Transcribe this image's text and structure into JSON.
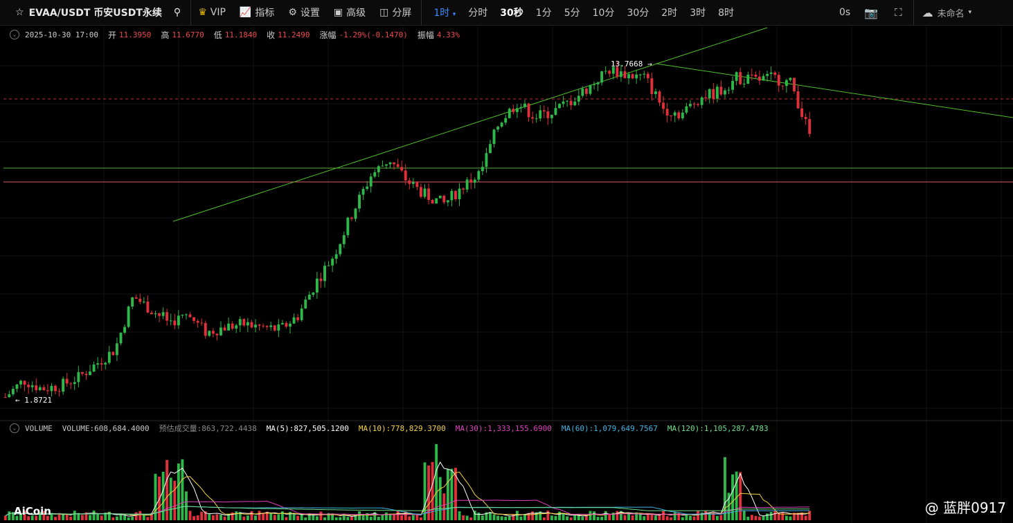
{
  "toolbar": {
    "symbol": "EVAA/USDT 币安USDT永续",
    "vip": "VIP",
    "indicators": "指标",
    "settings": "设置",
    "advanced": "高级",
    "split": "分屏",
    "current_interval": "1时",
    "intervals": [
      "分时",
      "30秒",
      "1分",
      "5分",
      "10分",
      "30分",
      "2时",
      "3时",
      "8时"
    ],
    "countdown": "0s",
    "layout_name": "未命名"
  },
  "ohlc": {
    "datetime": "2025-10-30 17:00",
    "open_label": "开",
    "open": "11.3950",
    "high_label": "高",
    "high": "11.6770",
    "low_label": "低",
    "low": "11.1840",
    "close_label": "收",
    "close": "11.2490",
    "change_label": "涨幅",
    "change": "-1.29%(-0.1470)",
    "amplitude_label": "振幅",
    "amplitude": "4.33%"
  },
  "annotations": {
    "high_marker": "13.7668 →",
    "low_marker": "← 1.8721"
  },
  "volume": {
    "title": "VOLUME",
    "value": "VOLUME:608,684.4000",
    "estimated": "预估成交量:863,722.4438",
    "ma5": "MA(5):827,505.1200",
    "ma10": "MA(10):778,829.3700",
    "ma30": "MA(30):1,333,155.6900",
    "ma60": "MA(60):1,079,649.7567",
    "ma120": "MA(120):1,105,287.4783"
  },
  "colors": {
    "up": "#2fb84a",
    "down": "#e0303a",
    "trend": "#4fbf2a",
    "ma5": "#ffffff",
    "ma10": "#f5d142",
    "ma30": "#e040c0",
    "ma60": "#3fb4e6",
    "ma120": "#6ee08a",
    "volume_label": "#c8c8c8",
    "estimated": "#8a8a8a"
  },
  "branding": {
    "logo": "AiCoin",
    "watermark": "@ 蓝胖0917"
  },
  "chart_data": {
    "type": "candlestick",
    "series": [
      {
        "name": "price-path",
        "values": [
          1.9,
          2.5,
          2.2,
          2.3,
          2.6,
          3.1,
          3.6,
          5.5,
          5.0,
          4.6,
          4.8,
          4.2,
          4.4,
          4.5,
          4.4,
          4.3,
          4.8,
          6.0,
          7.0,
          8.5,
          9.8,
          10.4,
          9.6,
          9.1,
          8.8,
          9.4,
          9.9,
          11.7,
          12.4,
          11.9,
          12.1,
          12.5,
          13.0,
          13.6,
          13.4,
          13.3,
          12.2,
          12.0,
          12.6,
          12.8,
          13.3,
          13.2,
          13.3,
          13.1,
          11.25
        ]
      }
    ],
    "price_levels": {
      "last": 11.249,
      "high": 13.7668,
      "low": 1.8721
    }
  }
}
